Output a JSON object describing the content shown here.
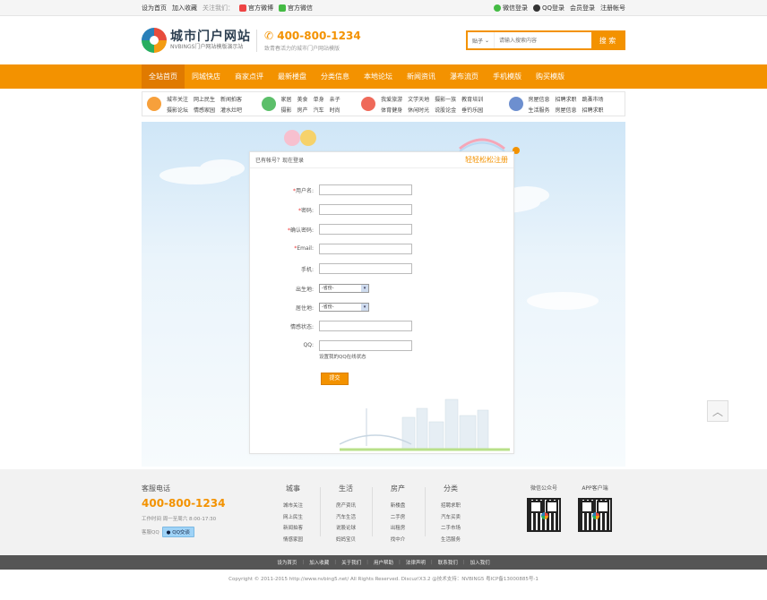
{
  "topbar": {
    "set_home": "设为首页",
    "add_fav": "加入收藏",
    "follow": "关注我们：",
    "weibo": "官方微博",
    "wechat": "官方微信",
    "wechat_login": "微信登录",
    "qq_login": "QQ登录",
    "member_login": "会员登录",
    "register": "注册帐号"
  },
  "header": {
    "logo_title": "城市门户网站",
    "logo_sub": "NVBINGS门户网站模版演示站",
    "hotline": "400-800-1234",
    "hotline_sub": "致青春活力的城市门户网站模版"
  },
  "search": {
    "scope": "贴子",
    "placeholder": "请输入搜索内容",
    "button": "搜 索"
  },
  "nav": [
    "全站首页",
    "同城快店",
    "商家点评",
    "最新楼盘",
    "分类信息",
    "本地论坛",
    "新闻资讯",
    "瀑布流页",
    "手机模版",
    "购买模版"
  ],
  "cats": [
    {
      "color": "#f7a03b",
      "items": [
        "城市关注",
        "网上民生",
        "新闻拍客",
        "摄影论坛",
        "情感家园",
        "灌水灶吧"
      ]
    },
    {
      "color": "#5cbf6a",
      "items": [
        "家居",
        "美食",
        "单身",
        "亲子",
        "摄影",
        "房产",
        "汽车",
        "时尚"
      ]
    },
    {
      "color": "#ef6a5a",
      "items": [
        "我爱旅游",
        "文学天地",
        "摄影一族",
        "教育培训",
        "体育健身",
        "休闲时光",
        "说股论金",
        "垂钓乐园"
      ]
    },
    {
      "color": "#6d8fcf",
      "items": [
        "房屋信息",
        "招聘求职",
        "跳蚤市场",
        "生活服务",
        "房屋信息",
        "招聘求职"
      ]
    }
  ],
  "form": {
    "head_left": "已有帐号？现在登录",
    "head_right": "轻轻松松注册",
    "username": "用户名:",
    "password": "密码:",
    "confirm": "确认密码:",
    "email": "Email:",
    "mobile": "手机:",
    "birthplace": "出生地:",
    "residence": "居住地:",
    "relationship": "情感状态:",
    "qq": "QQ:",
    "province": "-省份-",
    "qq_hint": "设置我的QQ在线状态",
    "submit": "提交"
  },
  "footer": {
    "service_title": "客服电话",
    "service_num": "400-800-1234",
    "service_time": "工作时间 周一至周六 8:00-17:30",
    "service_qq": "客服QQ",
    "qq_btn": "QQ交谈",
    "cols": [
      {
        "title": "城事",
        "items": [
          "城市关注",
          "网上民生",
          "新闻拍客",
          "情感家园"
        ]
      },
      {
        "title": "生活",
        "items": [
          "房产资讯",
          "汽车生活",
          "说股论球",
          "妈妈宝贝"
        ]
      },
      {
        "title": "房产",
        "items": [
          "新楼盘",
          "二手房",
          "出租房",
          "找中介"
        ]
      },
      {
        "title": "分类",
        "items": [
          "招聘求职",
          "汽车买卖",
          "二手市场",
          "生活服务"
        ]
      }
    ],
    "wechat_qr": "微信公众号",
    "app_qr": "APP客户端"
  },
  "links": [
    "设为首页",
    "加入收藏",
    "关于我们",
    "用户帮助",
    "法律声明",
    "联系我们",
    "加入我们"
  ],
  "copyright": "Copyright © 2011-2015 http://www.nvbing5.net/ All Rights Reserved. Discuz!X3.2 @技术支持：NVBING5 粤ICP备13000885号-1"
}
